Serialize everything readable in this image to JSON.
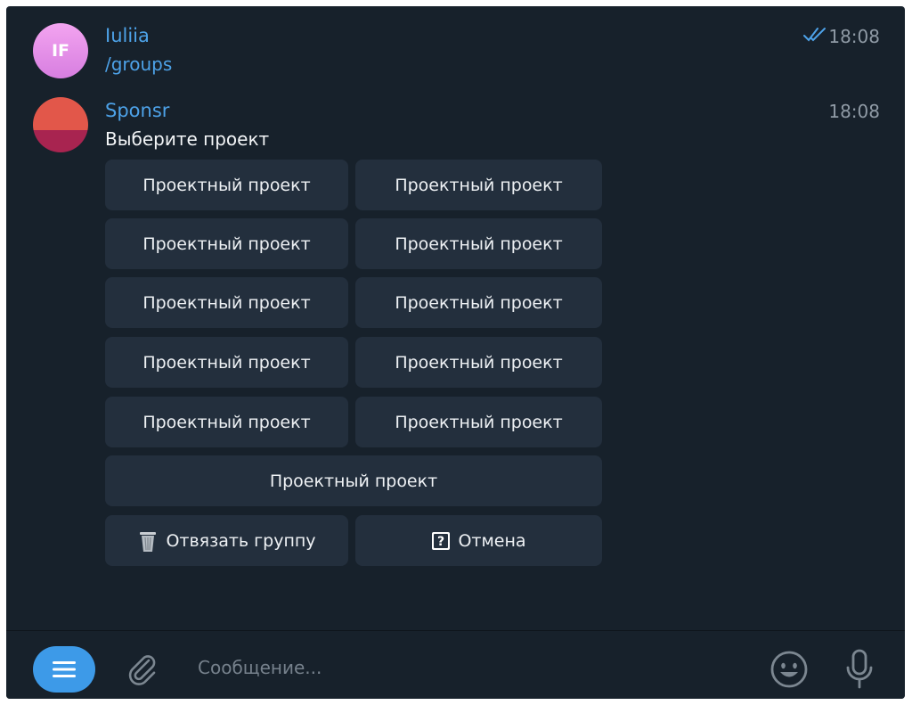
{
  "messages": [
    {
      "sender": "Iuliia",
      "avatar_initials": "IF",
      "text": "/groups",
      "time": "18:08",
      "status_icon": "double-check-icon"
    },
    {
      "sender": "Sponsr",
      "text": "Выберите проект",
      "time": "18:08"
    }
  ],
  "keyboard": {
    "buttons": [
      "Проектный проект",
      "Проектный проект",
      "Проектный проект",
      "Проектный проект",
      "Проектный проект",
      "Проектный проект",
      "Проектный проект",
      "Проектный проект",
      "Проектный проект",
      "Проектный проект",
      "Проектный проект"
    ],
    "unlink_label": "Отвязать группу",
    "unlink_icon": "trash-icon",
    "cancel_label": "Отмена",
    "cancel_icon": "question-box-icon"
  },
  "composer": {
    "placeholder": "Сообщение..."
  },
  "colors": {
    "background": "#17212b",
    "button": "#232f3d",
    "accent": "#4da2e8"
  }
}
